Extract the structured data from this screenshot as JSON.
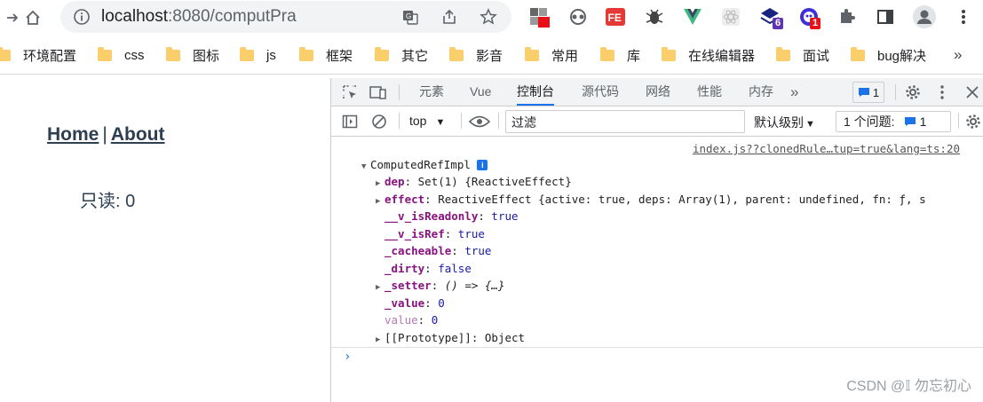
{
  "browser": {
    "url_host": "localhost",
    "url_rest": ":8080/computPra",
    "extension_badges": {
      "ext2": "",
      "ext8": "6",
      "ext9": "1"
    }
  },
  "bookmarks": [
    "环境配置",
    "css",
    "图标",
    "js",
    "框架",
    "其它",
    "影音",
    "常用",
    "库",
    "在线编辑器",
    "面试",
    "bug解决"
  ],
  "bookmarks_more": "»",
  "page": {
    "nav_home": "Home",
    "nav_sep": "|",
    "nav_about": "About",
    "readonly_text": "只读: 0"
  },
  "devtools": {
    "tabs": [
      "元素",
      "Vue",
      "控制台",
      "源代码",
      "网络",
      "性能",
      "内存"
    ],
    "active_tab": "控制台",
    "more_tabs": "»",
    "message_count": "1",
    "context": "top",
    "filter_placeholder": "过滤",
    "level": "默认级别",
    "issues_label": "1 个问题:",
    "issues_count": "1"
  },
  "console": {
    "source": "index.js??clonedRule…tup=true&lang=ts:20",
    "object_name": "ComputedRefImpl",
    "props": [
      {
        "key": "dep",
        "value": "Set(1) {ReactiveEffect}"
      },
      {
        "key": "effect",
        "value": "ReactiveEffect {active: true, deps: Array(1), parent: undefined, fn: ƒ, s"
      },
      {
        "key": "__v_isReadonly",
        "value": "true"
      },
      {
        "key": "__v_isRef",
        "value": "true"
      },
      {
        "key": "_cacheable",
        "value": "true"
      },
      {
        "key": "_dirty",
        "value": "false"
      },
      {
        "key": "_setter",
        "value": "() => {…}"
      },
      {
        "key": "_value",
        "value": "0"
      },
      {
        "key": "value",
        "value": "0"
      },
      {
        "key": "[[Prototype]]",
        "value": "Object"
      }
    ],
    "prompt": "›"
  },
  "watermark": "CSDN @𝕀 勿忘初心",
  "colors": {
    "accent": "#1a73e8",
    "prop_key": "#881280",
    "bool": "#1a1aa6"
  }
}
